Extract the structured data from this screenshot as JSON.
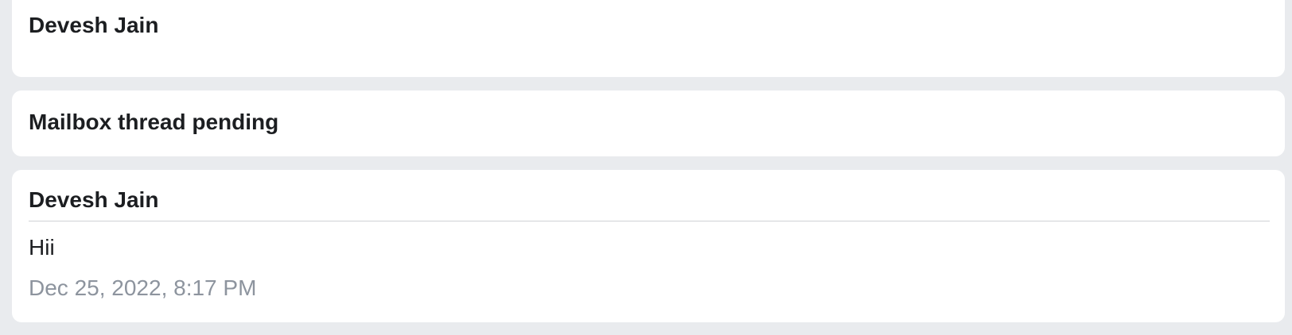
{
  "cards": [
    {
      "title": "Devesh Jain"
    },
    {
      "title": "Mailbox thread pending"
    },
    {
      "title": "Devesh Jain",
      "message": "Hii",
      "timestamp": "Dec 25, 2022, 8:17 PM"
    }
  ],
  "colors": {
    "background": "#e9ebee",
    "card": "#ffffff",
    "text": "#1c1e21",
    "muted": "#8d949e",
    "divider": "#cfd1d5"
  }
}
